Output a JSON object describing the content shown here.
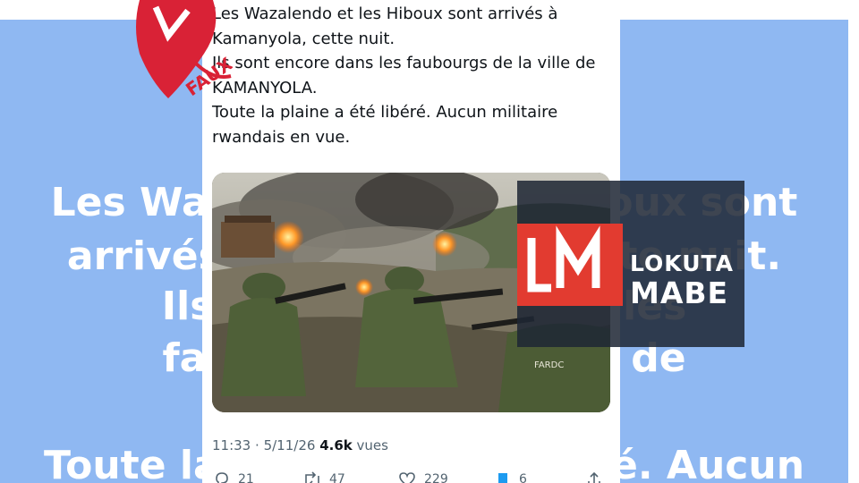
{
  "background": {
    "color": "#8fb8f2",
    "lines": [
      "Les Wazalendo et les Hiboux sont",
      "arrivés à Kamanyola, cette nuit.",
      "Ils sont encore dans les",
      "faubourgs de la ville de",
      "Toute la plaine a été libéré. Aucun"
    ]
  },
  "tweet": {
    "lines": [
      "Les Wazalendo et les Hiboux sont arrivés à",
      "Kamanyola, cette nuit.",
      "Ils sont encore dans les faubourgs de la ville de",
      "KAMANYOLA.",
      "Toute la plaine a été libéré. Aucun militaire",
      "rwandais en vue."
    ],
    "image_badge": "FARDC",
    "time": "11:33",
    "separator": "·",
    "date": "5/11/26",
    "views_count": "4.6k",
    "views_label": "vues",
    "replies": "21",
    "reposts": "47",
    "likes": "229",
    "bookmarks": "6"
  },
  "stamp": {
    "text": "FAUX",
    "color": "#d92236"
  },
  "logo": {
    "line1": "LOKUTA",
    "line2": "MABE",
    "red": "#e23b30"
  }
}
